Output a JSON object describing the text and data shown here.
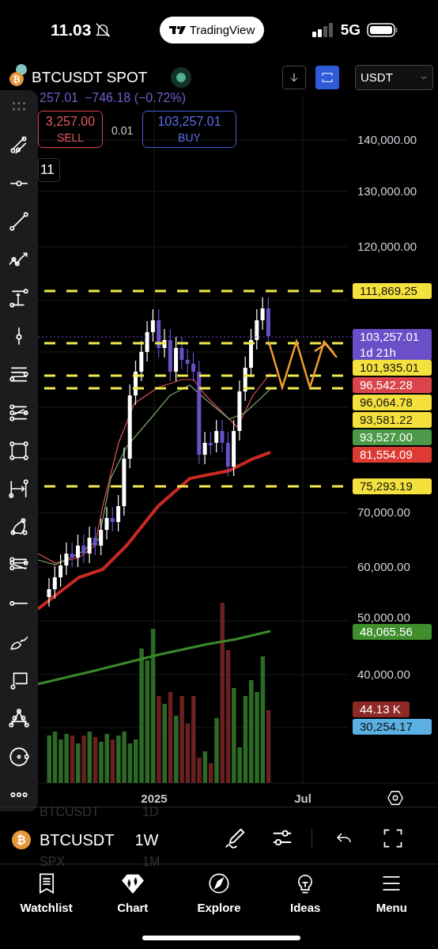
{
  "status_bar": {
    "time": "11.03",
    "app_pill": "TradingView",
    "network": "5G"
  },
  "header": {
    "coin_glyph": "₿",
    "symbol": "BTCUSDT SPOT",
    "currency": "USDT"
  },
  "quote": {
    "last": "257.01",
    "change": "−746.18 (−0.72%)"
  },
  "trade": {
    "sell_price": "3,257.00",
    "sell_label": "SELL",
    "spread": "0.01",
    "buy_price": "103,257.01",
    "buy_label": "BUY",
    "quantity": "11"
  },
  "price_axis": [
    "140,000.00",
    "130,000.00",
    "120,000.00",
    "70,000.00",
    "60,000.00",
    "50,000.00",
    "40,000.00"
  ],
  "price_labels": [
    {
      "text": "111,869.25",
      "color": "#f5e13d"
    },
    {
      "text": "103,257.01",
      "sub": "1d 21h",
      "color": "#6a4fc8"
    },
    {
      "text": "101,935.01",
      "color": "#f5e13d"
    },
    {
      "text": "96,542.28",
      "color": "#d9454a"
    },
    {
      "text": "96,064.78",
      "color": "#f5e13d"
    },
    {
      "text": "93,581.22",
      "color": "#f5e13d"
    },
    {
      "text": "93,527.00",
      "color": "#4c9a48"
    },
    {
      "text": "81,554.09",
      "color": "#dc3a32"
    },
    {
      "text": "75,293.19",
      "color": "#f5e13d"
    },
    {
      "text": "48,065.56",
      "color": "#3f8f2c"
    },
    {
      "text": "44.13 K",
      "color": "#8e2a26"
    },
    {
      "text": "30,254.17",
      "color": "#5aafe3"
    }
  ],
  "time_axis": [
    "2025",
    "Jul"
  ],
  "symbol_bar": {
    "coin_glyph": "₿",
    "prev_symbol": "BTCUSDT",
    "prev_interval": "1D",
    "symbol": "BTCUSDT",
    "interval": "1W",
    "next_symbol": "SPX",
    "next_interval": "1M"
  },
  "nav": [
    "Watchlist",
    "Chart",
    "Explore",
    "Ideas",
    "Menu"
  ]
}
